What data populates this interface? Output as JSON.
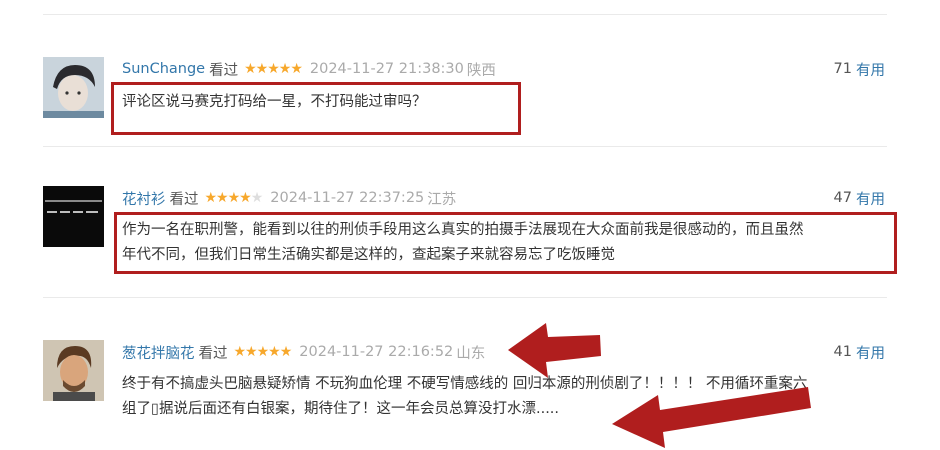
{
  "reviews": [
    {
      "user": "SunChange",
      "status": "看过",
      "rating": 5,
      "stars_on": "★★★★★",
      "stars_off": "",
      "time": "2024-11-27 21:38:30",
      "location": "陕西",
      "votes": "71",
      "useful_label": "有用",
      "content": "评论区说马赛克打码给一星，不打码能过审吗？"
    },
    {
      "user": "花衬衫",
      "status": "看过",
      "rating": 4,
      "stars_on": "★★★★",
      "stars_off": "★",
      "time": "2024-11-27 22:37:25",
      "location": "江苏",
      "votes": "47",
      "useful_label": "有用",
      "content_line1": "作为一名在职刑警，能看到以往的刑侦手段用这么真实的拍摄手法展现在大众面前我是很感动的，而且虽然",
      "content_line2": "年代不同，但我们日常生活确实都是这样的，查起案子来就容易忘了吃饭睡觉"
    },
    {
      "user": "葱花拌脑花",
      "status": "看过",
      "rating": 5,
      "stars_on": "★★★★★",
      "stars_off": "",
      "time": "2024-11-27 22:16:52",
      "location": "山东",
      "votes": "41",
      "useful_label": "有用",
      "content_line1": "终于有不搞虚头巴脑悬疑矫情 不玩狗血伦理 不硬写情感线的 回归本源的刑侦剧了！！！！ 不用循环重案六",
      "content_line2": "组了▯据说后面还有白银案，期待住了！这一年会员总算没打水漂....."
    }
  ],
  "colors": {
    "link": "#3377aa",
    "star": "#f7a82c",
    "highlight": "#b01e1e"
  }
}
